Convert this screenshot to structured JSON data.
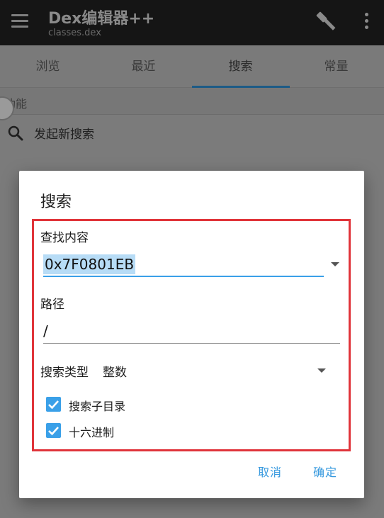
{
  "appbar": {
    "title": "Dex编辑器++",
    "subtitle": "classes.dex",
    "icons": [
      "menu-icon",
      "hammer-icon",
      "overflow-menu-icon"
    ]
  },
  "tabs": [
    {
      "label": "浏览",
      "active": false
    },
    {
      "label": "最近",
      "active": false
    },
    {
      "label": "搜索",
      "active": true
    },
    {
      "label": "常量",
      "active": false
    }
  ],
  "section": {
    "label": "功能"
  },
  "list": {
    "new_search_label": "发起新搜索",
    "icon": "search-icon"
  },
  "dialog": {
    "title": "搜索",
    "find_label": "查找内容",
    "find_value": "0x7F0801EB",
    "path_label": "路径",
    "path_value": "/",
    "type_label": "搜索类型",
    "type_value": "整数",
    "checkboxes": [
      {
        "label": "搜索子目录",
        "checked": true
      },
      {
        "label": "十六进制",
        "checked": true
      }
    ],
    "cancel_label": "取消",
    "ok_label": "确定"
  },
  "colors": {
    "accent": "#3aa0e8",
    "highlight_border": "#e0343a",
    "selection": "#b7dcf6"
  }
}
